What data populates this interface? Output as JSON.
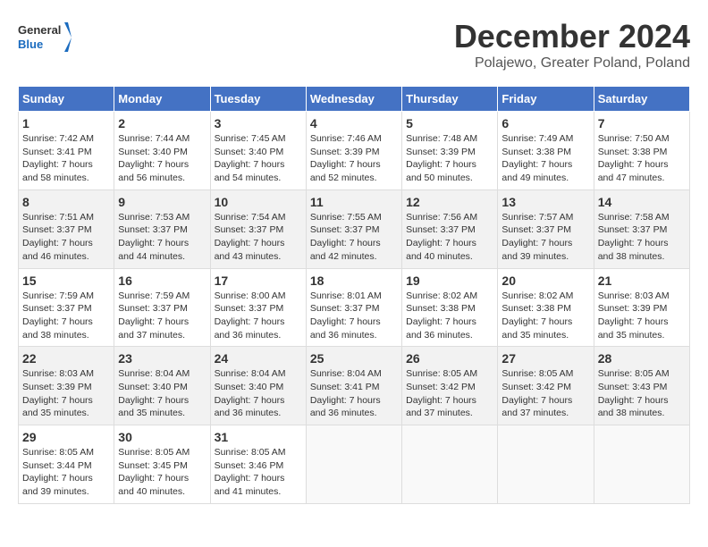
{
  "header": {
    "logo_general": "General",
    "logo_blue": "Blue",
    "month_title": "December 2024",
    "subtitle": "Polajewo, Greater Poland, Poland"
  },
  "days_of_week": [
    "Sunday",
    "Monday",
    "Tuesday",
    "Wednesday",
    "Thursday",
    "Friday",
    "Saturday"
  ],
  "weeks": [
    [
      {
        "day": "1",
        "sunrise": "Sunrise: 7:42 AM",
        "sunset": "Sunset: 3:41 PM",
        "daylight": "Daylight: 7 hours and 58 minutes."
      },
      {
        "day": "2",
        "sunrise": "Sunrise: 7:44 AM",
        "sunset": "Sunset: 3:40 PM",
        "daylight": "Daylight: 7 hours and 56 minutes."
      },
      {
        "day": "3",
        "sunrise": "Sunrise: 7:45 AM",
        "sunset": "Sunset: 3:40 PM",
        "daylight": "Daylight: 7 hours and 54 minutes."
      },
      {
        "day": "4",
        "sunrise": "Sunrise: 7:46 AM",
        "sunset": "Sunset: 3:39 PM",
        "daylight": "Daylight: 7 hours and 52 minutes."
      },
      {
        "day": "5",
        "sunrise": "Sunrise: 7:48 AM",
        "sunset": "Sunset: 3:39 PM",
        "daylight": "Daylight: 7 hours and 50 minutes."
      },
      {
        "day": "6",
        "sunrise": "Sunrise: 7:49 AM",
        "sunset": "Sunset: 3:38 PM",
        "daylight": "Daylight: 7 hours and 49 minutes."
      },
      {
        "day": "7",
        "sunrise": "Sunrise: 7:50 AM",
        "sunset": "Sunset: 3:38 PM",
        "daylight": "Daylight: 7 hours and 47 minutes."
      }
    ],
    [
      {
        "day": "8",
        "sunrise": "Sunrise: 7:51 AM",
        "sunset": "Sunset: 3:37 PM",
        "daylight": "Daylight: 7 hours and 46 minutes."
      },
      {
        "day": "9",
        "sunrise": "Sunrise: 7:53 AM",
        "sunset": "Sunset: 3:37 PM",
        "daylight": "Daylight: 7 hours and 44 minutes."
      },
      {
        "day": "10",
        "sunrise": "Sunrise: 7:54 AM",
        "sunset": "Sunset: 3:37 PM",
        "daylight": "Daylight: 7 hours and 43 minutes."
      },
      {
        "day": "11",
        "sunrise": "Sunrise: 7:55 AM",
        "sunset": "Sunset: 3:37 PM",
        "daylight": "Daylight: 7 hours and 42 minutes."
      },
      {
        "day": "12",
        "sunrise": "Sunrise: 7:56 AM",
        "sunset": "Sunset: 3:37 PM",
        "daylight": "Daylight: 7 hours and 40 minutes."
      },
      {
        "day": "13",
        "sunrise": "Sunrise: 7:57 AM",
        "sunset": "Sunset: 3:37 PM",
        "daylight": "Daylight: 7 hours and 39 minutes."
      },
      {
        "day": "14",
        "sunrise": "Sunrise: 7:58 AM",
        "sunset": "Sunset: 3:37 PM",
        "daylight": "Daylight: 7 hours and 38 minutes."
      }
    ],
    [
      {
        "day": "15",
        "sunrise": "Sunrise: 7:59 AM",
        "sunset": "Sunset: 3:37 PM",
        "daylight": "Daylight: 7 hours and 38 minutes."
      },
      {
        "day": "16",
        "sunrise": "Sunrise: 7:59 AM",
        "sunset": "Sunset: 3:37 PM",
        "daylight": "Daylight: 7 hours and 37 minutes."
      },
      {
        "day": "17",
        "sunrise": "Sunrise: 8:00 AM",
        "sunset": "Sunset: 3:37 PM",
        "daylight": "Daylight: 7 hours and 36 minutes."
      },
      {
        "day": "18",
        "sunrise": "Sunrise: 8:01 AM",
        "sunset": "Sunset: 3:37 PM",
        "daylight": "Daylight: 7 hours and 36 minutes."
      },
      {
        "day": "19",
        "sunrise": "Sunrise: 8:02 AM",
        "sunset": "Sunset: 3:38 PM",
        "daylight": "Daylight: 7 hours and 36 minutes."
      },
      {
        "day": "20",
        "sunrise": "Sunrise: 8:02 AM",
        "sunset": "Sunset: 3:38 PM",
        "daylight": "Daylight: 7 hours and 35 minutes."
      },
      {
        "day": "21",
        "sunrise": "Sunrise: 8:03 AM",
        "sunset": "Sunset: 3:39 PM",
        "daylight": "Daylight: 7 hours and 35 minutes."
      }
    ],
    [
      {
        "day": "22",
        "sunrise": "Sunrise: 8:03 AM",
        "sunset": "Sunset: 3:39 PM",
        "daylight": "Daylight: 7 hours and 35 minutes."
      },
      {
        "day": "23",
        "sunrise": "Sunrise: 8:04 AM",
        "sunset": "Sunset: 3:40 PM",
        "daylight": "Daylight: 7 hours and 35 minutes."
      },
      {
        "day": "24",
        "sunrise": "Sunrise: 8:04 AM",
        "sunset": "Sunset: 3:40 PM",
        "daylight": "Daylight: 7 hours and 36 minutes."
      },
      {
        "day": "25",
        "sunrise": "Sunrise: 8:04 AM",
        "sunset": "Sunset: 3:41 PM",
        "daylight": "Daylight: 7 hours and 36 minutes."
      },
      {
        "day": "26",
        "sunrise": "Sunrise: 8:05 AM",
        "sunset": "Sunset: 3:42 PM",
        "daylight": "Daylight: 7 hours and 37 minutes."
      },
      {
        "day": "27",
        "sunrise": "Sunrise: 8:05 AM",
        "sunset": "Sunset: 3:42 PM",
        "daylight": "Daylight: 7 hours and 37 minutes."
      },
      {
        "day": "28",
        "sunrise": "Sunrise: 8:05 AM",
        "sunset": "Sunset: 3:43 PM",
        "daylight": "Daylight: 7 hours and 38 minutes."
      }
    ],
    [
      {
        "day": "29",
        "sunrise": "Sunrise: 8:05 AM",
        "sunset": "Sunset: 3:44 PM",
        "daylight": "Daylight: 7 hours and 39 minutes."
      },
      {
        "day": "30",
        "sunrise": "Sunrise: 8:05 AM",
        "sunset": "Sunset: 3:45 PM",
        "daylight": "Daylight: 7 hours and 40 minutes."
      },
      {
        "day": "31",
        "sunrise": "Sunrise: 8:05 AM",
        "sunset": "Sunset: 3:46 PM",
        "daylight": "Daylight: 7 hours and 41 minutes."
      },
      null,
      null,
      null,
      null
    ]
  ]
}
